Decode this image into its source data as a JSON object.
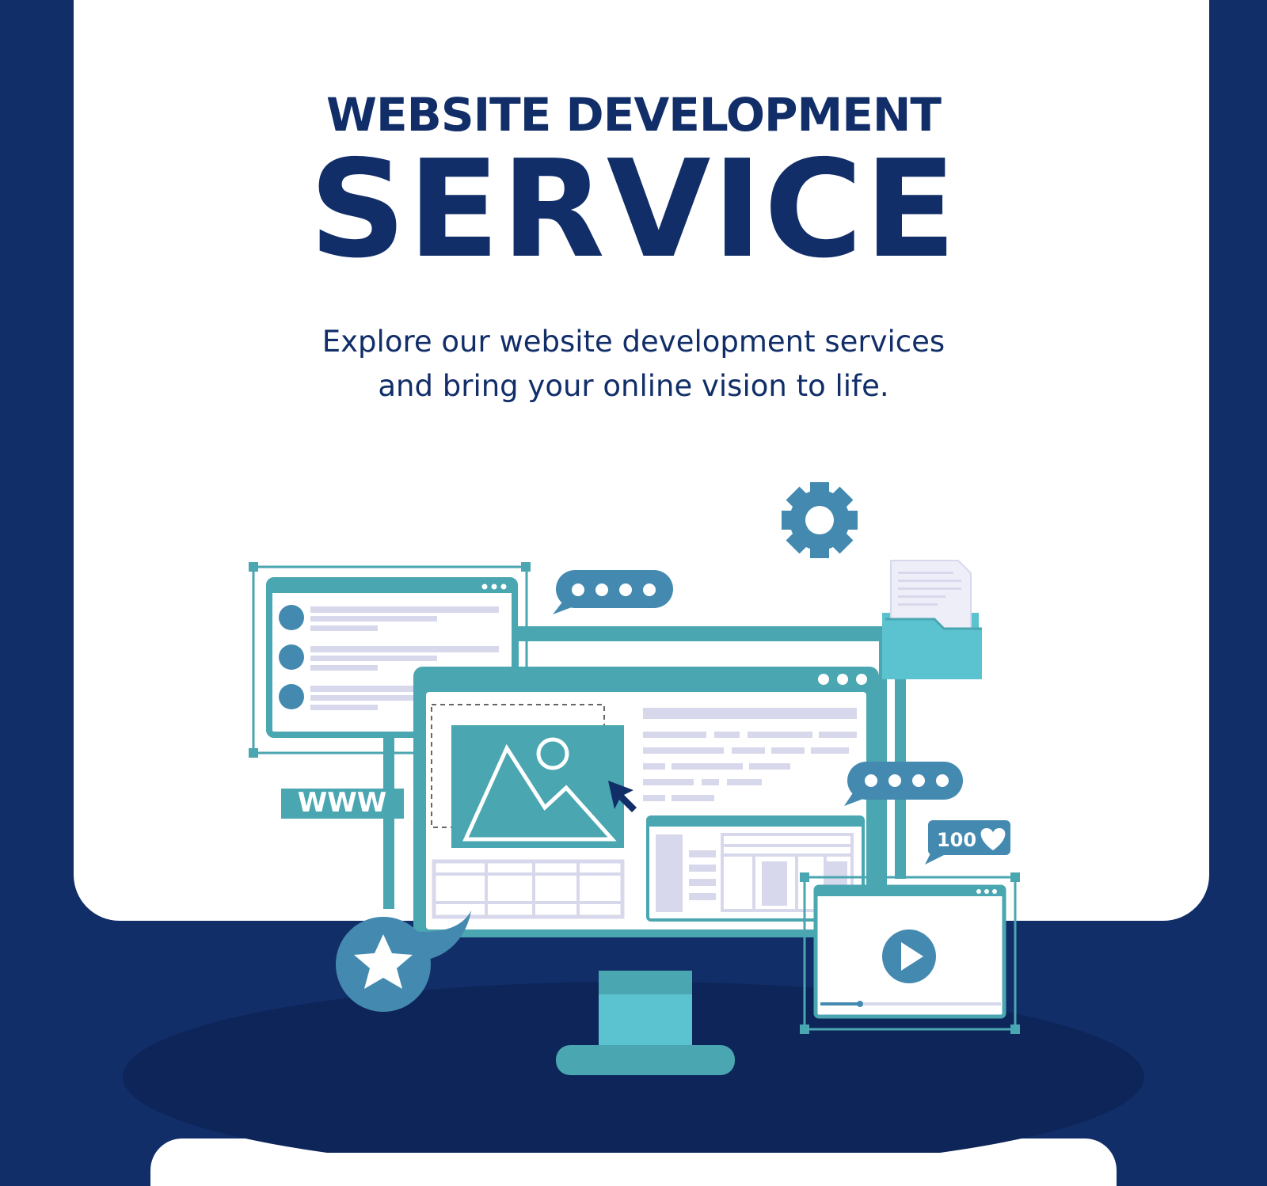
{
  "hero": {
    "kicker": "WEBSITE DEVELOPMENT",
    "headline": "SERVICE",
    "subtitle_line1": "Explore our website development services",
    "subtitle_line2": "and bring your online vision to life."
  },
  "illustration": {
    "www_label": "WWW",
    "likes_label": "100"
  },
  "colors": {
    "navy": "#112e69",
    "deep_navy": "#0d2558",
    "teal": "#4aa6b0",
    "teal_light": "#5bc3cf",
    "steel_blue": "#448ab0",
    "lavender": "#d8d8ec",
    "white": "#ffffff"
  }
}
